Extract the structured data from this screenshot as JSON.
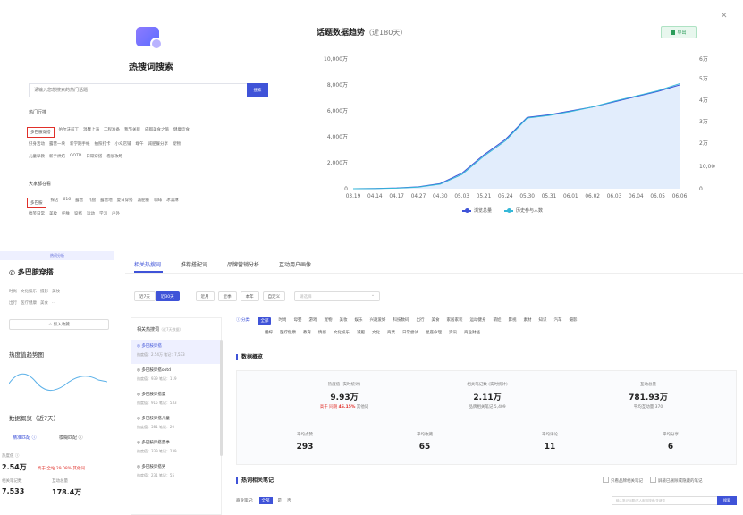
{
  "search": {
    "title": "热搜词搜索",
    "placeholder": "请输入您想搜索的热门话题",
    "button": "搜索",
    "recent_label": "热门行搜",
    "recent_rows": [
      [
        "多巴胺穿搭",
        "伯尔沃兹丁",
        "温馨上海",
        "工程准备",
        "我节关联",
        "成都美食之旅",
        "健康饮食"
      ],
      [
        "好身活动",
        "露营一块",
        "新学期手帐",
        "拍照打卡",
        "小众店铺",
        "端午",
        "减肥餐分享",
        "宠物"
      ],
      [
        "儿童早教",
        "新手烘焙",
        "OOTD",
        "日常穿搭",
        "看展攻略"
      ]
    ],
    "fav_label": "大家都在看",
    "fav_rows": [
      [
        "多巴胺",
        "探店",
        "616",
        "露营",
        "飞盘",
        "露营地",
        "夏日穿搭",
        "减肥餐",
        "咖啡",
        "冰淇淋"
      ],
      [
        "搞笑日常",
        "美妆",
        "护肤",
        "穿搭",
        "运动",
        "学习",
        "户外"
      ]
    ]
  },
  "chart_header": {
    "title": "话题数据趋势",
    "subtitle": "（近180天）",
    "export": "导出"
  },
  "chart_data": {
    "type": "area",
    "x": [
      "03.19",
      "04.14",
      "04.17",
      "04.27",
      "04.30",
      "05.03",
      "05.21",
      "05.24",
      "05.30",
      "05.31",
      "06.01",
      "06.02",
      "06.03",
      "06.04",
      "06.05",
      "06.06"
    ],
    "y_left_ticks": [
      "0",
      "2,000万",
      "4,000万",
      "6,000万",
      "8,000万",
      "10,000万"
    ],
    "y_right_ticks": [
      "0",
      "10,000",
      "2万",
      "3万",
      "4万",
      "5万",
      "6万"
    ],
    "ylim_left": [
      0,
      10000
    ],
    "ylim_right": [
      0,
      60000
    ],
    "series": [
      {
        "name": "浏览总量",
        "color": "#3f53d8",
        "values": [
          0,
          20,
          60,
          150,
          400,
          1200,
          2600,
          3800,
          5500,
          5700,
          6000,
          6300,
          6700,
          7100,
          7500,
          8000
        ]
      },
      {
        "name": "历史参与人数",
        "color": "#36b8d8",
        "values": [
          0,
          10,
          40,
          120,
          350,
          1100,
          2500,
          3700,
          5450,
          5650,
          5950,
          6300,
          6750,
          7150,
          7550,
          8100
        ]
      }
    ],
    "legend": "bottom"
  },
  "sidebar": {
    "top_label": "热词分析",
    "name": "多巴胺穿搭",
    "tags_row1": [
      "时尚",
      "文化娱乐",
      "摄影",
      "美妆"
    ],
    "tags_row2": [
      "出行",
      "医疗健康",
      "美食",
      "..."
    ],
    "follow": "☆ 加入收藏",
    "heat_title": "热度值趋势图",
    "data_title": "数据概览（近7天）",
    "tab_precise": "精准匹配 ⓘ",
    "tab_fuzzy": "模糊匹配 ⓘ",
    "heat_label": "热度值 ⓘ",
    "heat_value": "2.54万",
    "heat_note": "高于 全站 29.08% 其他词",
    "notes_label": "相关笔记数",
    "notes_value": "7,533",
    "inter_label": "互动总量",
    "inter_value": "178.4万"
  },
  "tabs": [
    "相关热搜词",
    "推荐搭配词",
    "品牌营销分析",
    "互动用户画像"
  ],
  "filters": {
    "range": [
      "近7天",
      "近30天"
    ],
    "period": [
      "近月",
      "近季",
      "本年",
      "自定义"
    ],
    "date_placeholder": "请选择"
  },
  "related": {
    "header": "相关热搜词",
    "header_sub": "（近7天数据）",
    "items": [
      {
        "name": "◎ 多巴胺穿搭",
        "sub": "热度值：2.54万   笔记：7,533"
      },
      {
        "name": "◎ 多巴胺穿搭ootd",
        "sub": "热度值：939   笔记：119"
      },
      {
        "name": "◎ 多巴胺穿搭夏",
        "sub": "热度值：915   笔记：533"
      },
      {
        "name": "◎ 多巴胺穿搭儿童",
        "sub": "热度值：581   笔记：20"
      },
      {
        "name": "◎ 多巴胺穿搭夏季",
        "sub": "热度值：339   笔记：239"
      },
      {
        "name": "◎ 多巴胺穿搭男",
        "sub": "热度值：231   笔记：55"
      }
    ]
  },
  "categories": {
    "label": "ⓘ 分类:",
    "all": "全部",
    "row1": [
      "时尚",
      "母婴",
      "游戏",
      "宠物",
      "美妆",
      "娱乐",
      "兴趣爱好",
      "科技数码",
      "出行",
      "美食",
      "家居家装",
      "运动健身",
      "萌娃",
      "影视",
      "素材",
      "知识",
      "汽车",
      "摄影"
    ],
    "row2": [
      "婚嫁",
      "医疗健康",
      "教育",
      "情感",
      "文化娱乐",
      "减肥",
      "文化",
      "商業",
      "日常尝试",
      "星座命理",
      "资讯",
      "商业财经"
    ]
  },
  "overview": {
    "title": "数据概览",
    "heat_label": "热度值 (实时统计)",
    "heat_value": "9.93万",
    "heat_note_pre": "高于 同期",
    "heat_note_pct": "46.15%",
    "heat_note_post": "其他词",
    "notes_label": "相关笔记数 (实时统计)",
    "notes_value": "2.11万",
    "notes_sub": "品牌相关笔记 5,409",
    "inter_label": "互动总量",
    "inter_value": "781.93万",
    "inter_sub": "平均互动量 370",
    "avg_like_label": "平均点赞",
    "avg_like": "293",
    "avg_fav_label": "平均收藏",
    "avg_fav": "65",
    "avg_cmt_label": "平均评论",
    "avg_cmt": "11",
    "avg_share_label": "平均分享",
    "avg_share": "6"
  },
  "notes_section": {
    "title": "热词相关笔记",
    "check1": "只看品牌相关笔记",
    "check2": "屏蔽已删除或隐藏的笔记",
    "biz_label": "商业笔记:",
    "biz_all": "全部",
    "biz_yes": "是",
    "biz_no": "否",
    "search_placeholder": "输入笔记标题/达人昵称搜索/关键词",
    "search_button": "搜索"
  }
}
